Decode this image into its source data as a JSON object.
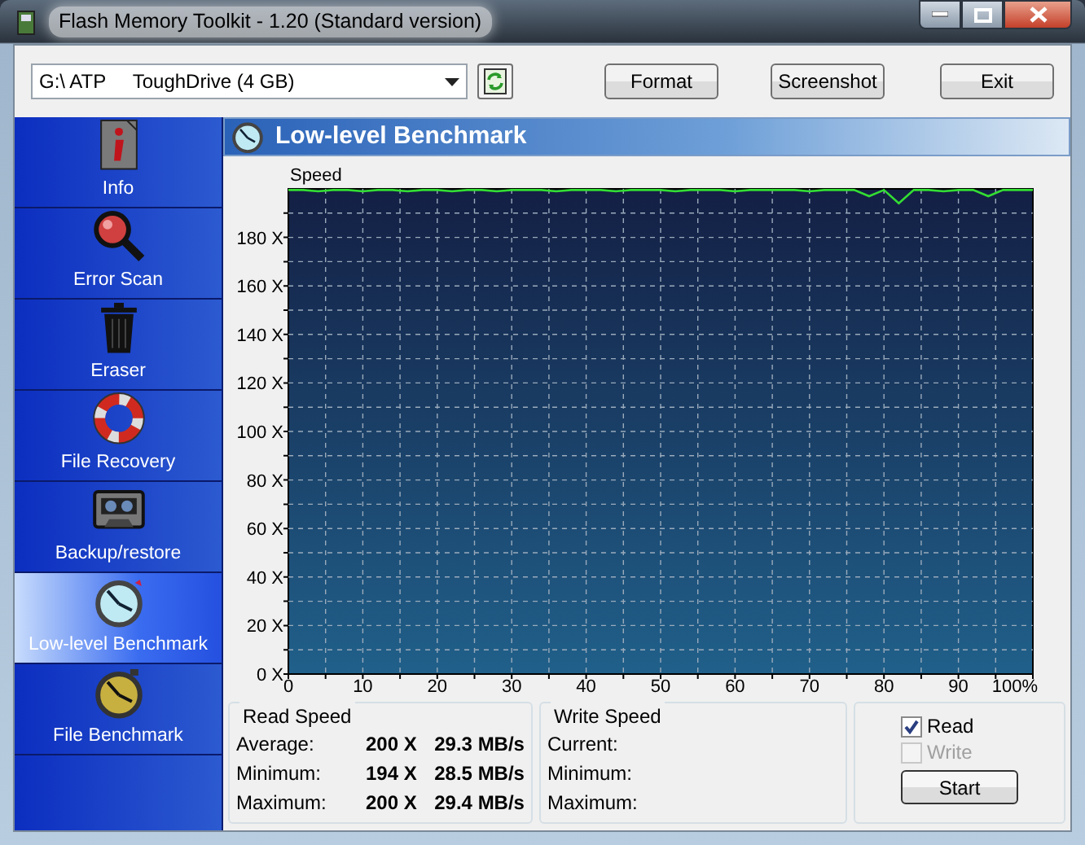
{
  "window": {
    "title": "Flash Memory Toolkit - 1.20 (Standard version)"
  },
  "toolbar": {
    "drive": {
      "value": "G:\\ ATP     ToughDrive (4 GB)"
    },
    "buttons": [
      "Format",
      "Screenshot",
      "Exit"
    ]
  },
  "sidebar": {
    "items": [
      {
        "label": "Info",
        "selected": false
      },
      {
        "label": "Error Scan",
        "selected": false
      },
      {
        "label": "Eraser",
        "selected": false
      },
      {
        "label": "File Recovery",
        "selected": false
      },
      {
        "label": "Backup/restore",
        "selected": false
      },
      {
        "label": "Low-level Benchmark",
        "selected": true
      },
      {
        "label": "File Benchmark",
        "selected": false
      }
    ]
  },
  "panel": {
    "title": "Low-level Benchmark",
    "chart_data": {
      "type": "line",
      "grid": true,
      "ylabel": "Speed",
      "xlim": [
        0,
        100
      ],
      "ylim": [
        0,
        200
      ],
      "xticks": [
        0,
        10,
        20,
        30,
        40,
        50,
        60,
        70,
        80,
        90,
        {
          "value": 100,
          "label": "100%"
        }
      ],
      "yticks": [
        {
          "value": 0,
          "label": "0 X"
        },
        {
          "value": 20,
          "label": "20 X"
        },
        {
          "value": 40,
          "label": "40 X"
        },
        {
          "value": 60,
          "label": "60 X"
        },
        {
          "value": 80,
          "label": "80 X"
        },
        {
          "value": 100,
          "label": "100 X"
        },
        {
          "value": 120,
          "label": "120 X"
        },
        {
          "value": 140,
          "label": "140 X"
        },
        {
          "value": 160,
          "label": "160 X"
        },
        {
          "value": 180,
          "label": "180 X"
        }
      ],
      "x": [
        0,
        2,
        4,
        6,
        8,
        10,
        12,
        14,
        16,
        18,
        20,
        22,
        24,
        26,
        28,
        30,
        32,
        34,
        36,
        38,
        40,
        42,
        44,
        46,
        48,
        50,
        52,
        54,
        56,
        58,
        60,
        62,
        64,
        66,
        68,
        70,
        72,
        74,
        76,
        78,
        80,
        82,
        84,
        86,
        88,
        90,
        92,
        94,
        96,
        98,
        100
      ],
      "series": [
        {
          "color": "#33dd33",
          "values": [
            199.5,
            199.5,
            199,
            199.5,
            199.5,
            199,
            199.5,
            199.5,
            199,
            199.5,
            199.5,
            199,
            199.5,
            199.5,
            199,
            199.5,
            199.5,
            199.5,
            199,
            199.5,
            199.5,
            199.5,
            199,
            199.5,
            199.5,
            199.5,
            199,
            199.5,
            199.5,
            199.5,
            199,
            199.5,
            199.5,
            199.5,
            199.5,
            199,
            199.5,
            199.5,
            199.5,
            197,
            199.5,
            194,
            199.5,
            199.5,
            199,
            199.5,
            199.5,
            197,
            199.5,
            199.5,
            199.5
          ]
        }
      ]
    }
  },
  "read_speed": {
    "title": "Read Speed",
    "rows": [
      {
        "label": "Average:",
        "multiple": "200 X",
        "rate": "29.3 MB/s"
      },
      {
        "label": "Minimum:",
        "multiple": "194 X",
        "rate": "28.5 MB/s"
      },
      {
        "label": "Maximum:",
        "multiple": "200 X",
        "rate": "29.4 MB/s"
      }
    ]
  },
  "write_speed": {
    "title": "Write Speed",
    "rows": [
      {
        "label": "Current:"
      },
      {
        "label": "Minimum:"
      },
      {
        "label": "Maximum:"
      }
    ]
  },
  "options": [
    {
      "label": "Read",
      "checked": true,
      "disabled": false
    },
    {
      "label": "Write",
      "checked": false,
      "disabled": true
    }
  ],
  "start_button": "Start"
}
